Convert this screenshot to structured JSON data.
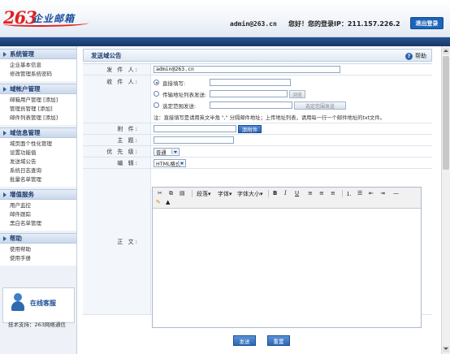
{
  "header": {
    "logo_number": "263",
    "logo_word": "企业邮箱",
    "user_email": "admin@263.cn",
    "greeting": "您好！您的登录IP：211.157.226.2",
    "logout_label": "退出登录"
  },
  "sidebar": {
    "sections": [
      {
        "title": "系统管理",
        "items": [
          "企业基本信息",
          "修改管理系统密码"
        ]
      },
      {
        "title": "域帐户管理",
        "items": [
          "邮箱用户管理 [添加]",
          "管理员管理 [添加]",
          "邮件列表管理 [添加]"
        ]
      },
      {
        "title": "域信息管理",
        "items": [
          "域页面个性化管理",
          "设置功能值",
          "发送域公告",
          "系统日志查询",
          "批量名单管理"
        ]
      },
      {
        "title": "增值服务",
        "items": [
          "用户监控",
          "邮件跟踪",
          "黑白名单管理"
        ]
      },
      {
        "title": "帮助",
        "items": [
          "使用帮助",
          "使用手册"
        ]
      }
    ],
    "support_label": "在线客服",
    "tech_support": "技术支持：263网络通信"
  },
  "main": {
    "title": "发送域公告",
    "help_label": "帮助",
    "form": {
      "sender_label": "发 件 人:",
      "sender_value": "admin@263.cn",
      "recipient_label": "收 件 人:",
      "radio_direct": "直接填写:",
      "radio_list": "传输地址列表发送:",
      "browse_label": "浏览",
      "radio_range": "选定范围发送:",
      "choose_range_label": "选定范围发送",
      "note": "注：直接填写是请用英文半角 \",\" 分隔邮件地址；上传地址列表，请用每一行一个邮件地址的txt文件。",
      "attach_label": "附    件:",
      "attach_button": "添附件",
      "subject_label": "主    题:",
      "priority_label": "优 先 级:",
      "priority_value": "普通",
      "format_label": "编    辑:",
      "format_value": "HTML格式",
      "body_label": "正    文:"
    },
    "editor_toolbar": {
      "paragraph": "段落",
      "font": "字体",
      "font_size": "字体大小",
      "bold": "B",
      "italic": "I",
      "underline": "U",
      "hr": "—"
    },
    "send_label": "发送",
    "reset_label": "重置"
  }
}
